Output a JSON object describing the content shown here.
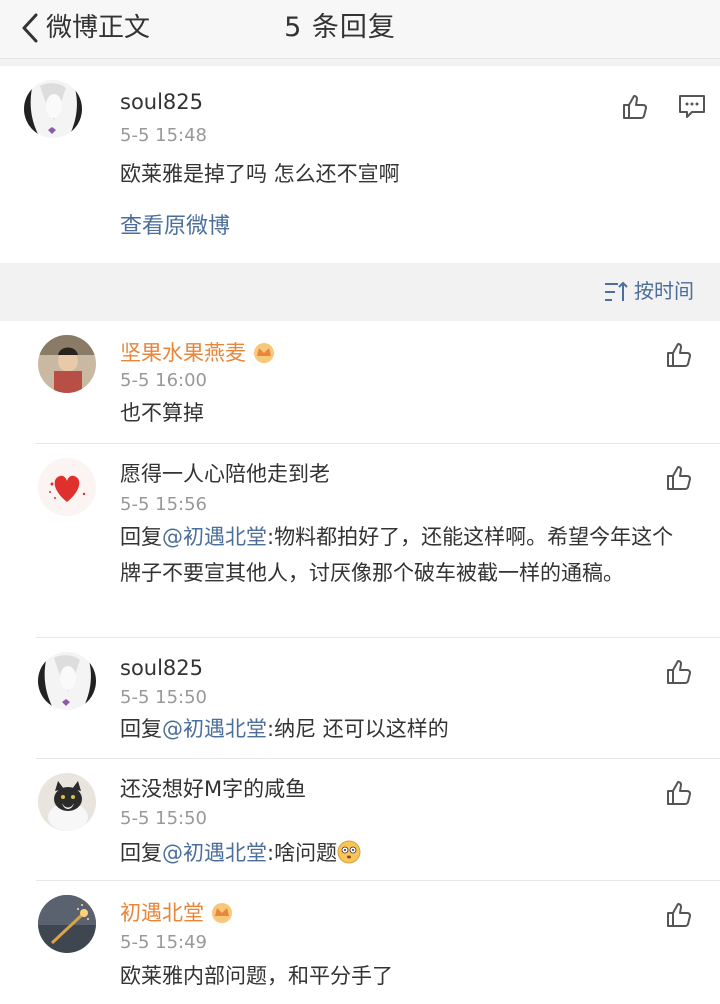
{
  "nav": {
    "back_label": "微博正文",
    "title": "5 条回复"
  },
  "original": {
    "user": "soul825",
    "time": "5-5 15:48",
    "text": "欧莱雅是掉了吗  怎么还不宣啊",
    "view_original": "查看原微博"
  },
  "sort": {
    "label": "按时间"
  },
  "replies": [
    {
      "user": "坚果水果燕麦",
      "vip": true,
      "time": "5-5 16:00",
      "prefix": "",
      "mention": "",
      "text": "也不算掉"
    },
    {
      "user": "愿得一人心陪他走到老",
      "vip": false,
      "time": "5-5 15:56",
      "prefix": "回复",
      "mention": "@初遇北堂",
      "text": ":物料都拍好了，还能这样啊。希望今年这个牌子不要宣其他人，讨厌像那个破车被截一样的通稿。"
    },
    {
      "user": "soul825",
      "vip": false,
      "time": "5-5 15:50",
      "prefix": "回复",
      "mention": "@初遇北堂",
      "text": ":纳尼   还可以这样的"
    },
    {
      "user": "还没想好M字的咸鱼",
      "vip": false,
      "time": "5-5 15:50",
      "prefix": "回复",
      "mention": "@初遇北堂",
      "text": ":啥问题"
    },
    {
      "user": "初遇北堂",
      "vip": true,
      "time": "5-5 15:49",
      "prefix": "",
      "mention": "",
      "text": "欧莱雅内部问题，和平分手了"
    }
  ],
  "colors": {
    "link": "#4b6e9a",
    "vip_name": "#e8863a",
    "meta": "#999999"
  }
}
